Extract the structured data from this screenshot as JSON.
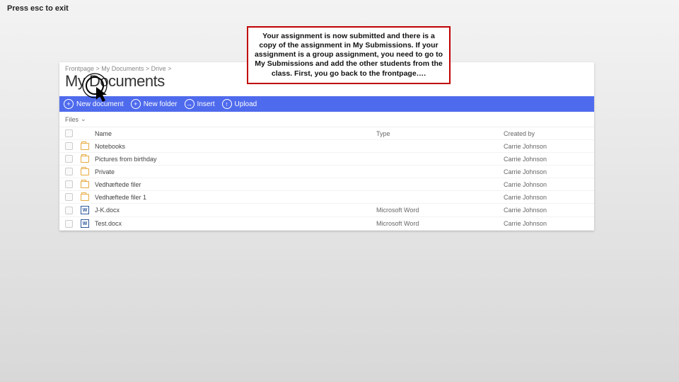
{
  "esc_hint": "Press esc to exit",
  "breadcrumb": {
    "parts": [
      "Frontpage",
      "My Documents",
      "Drive"
    ],
    "sep": " > "
  },
  "page_title": "My Documents",
  "toolbar": {
    "new_document": "New document",
    "new_folder": "New folder",
    "insert": "Insert",
    "upload": "Upload"
  },
  "filter_label": "Files",
  "columns": {
    "name": "Name",
    "type": "Type",
    "created_by": "Created by"
  },
  "rows": [
    {
      "icon": "folder",
      "name": "Notebooks",
      "type": "",
      "created_by": "Carrie Johnson"
    },
    {
      "icon": "folder",
      "name": "Pictures from birthday",
      "type": "",
      "created_by": "Carrie Johnson"
    },
    {
      "icon": "folder",
      "name": "Private",
      "type": "",
      "created_by": "Carrie Johnson"
    },
    {
      "icon": "folder",
      "name": "Vedhæftede filer",
      "type": "",
      "created_by": "Carrie Johnson"
    },
    {
      "icon": "folder",
      "name": "Vedhæftede filer 1",
      "type": "",
      "created_by": "Carrie Johnson"
    },
    {
      "icon": "word",
      "name": "J-K.docx",
      "type": "Microsoft Word",
      "created_by": "Carrie Johnson"
    },
    {
      "icon": "word",
      "name": "Test.docx",
      "type": "Microsoft Word",
      "created_by": "Carrie Johnson"
    }
  ],
  "callout_text": "Your assignment is now submitted and there is a copy of the assignment in My Submissions. If your assignment is a group assignment, you need to go to My Submissions and add the other students from the class. First, you go back to the frontpage…."
}
